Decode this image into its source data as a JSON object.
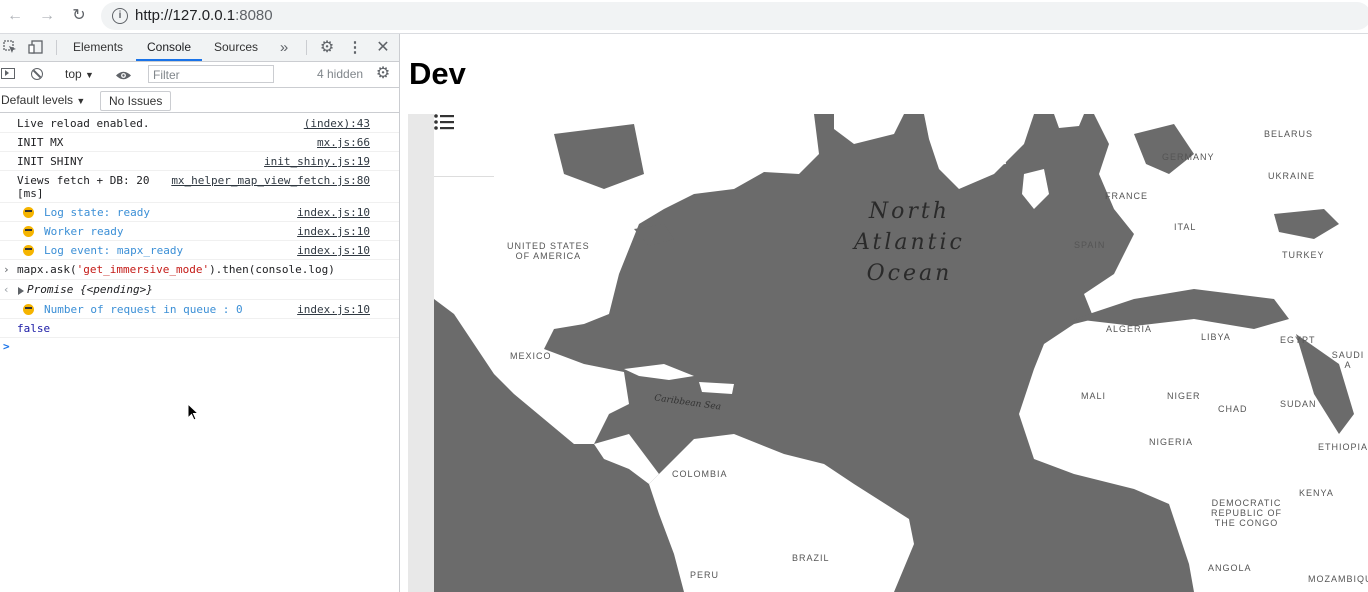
{
  "browser": {
    "url": "http://127.0.0.1:8080",
    "url_host": "http://127.0.0.1",
    "url_port": ":8080"
  },
  "devtools": {
    "tabs": [
      "Elements",
      "Console",
      "Sources"
    ],
    "selected_tab": "Console",
    "context": "top",
    "filter_placeholder": "Filter",
    "hidden_count": "4 hidden",
    "levels": "Default levels",
    "issues": "No Issues",
    "console_rows": [
      {
        "msg": "Live reload enabled.",
        "src": "(index):43"
      },
      {
        "msg": "INIT MX",
        "src": "mx.js:66"
      },
      {
        "msg": "INIT SHINY",
        "src": "init_shiny.js:19"
      },
      {
        "msg": "Views fetch + DB: 20\n[ms]",
        "src": "mx_helper_map_view_fetch.js:80"
      },
      {
        "msg": "Log state: ready",
        "src": "index.js:10"
      },
      {
        "msg": "Worker ready",
        "src": "index.js:10"
      },
      {
        "msg": "Log event: mapx_ready",
        "src": "index.js:10"
      },
      {
        "msg": "mapx.ask('get_immersive_mode').then(console.log)",
        "src": ""
      },
      {
        "msg": "Promise {<pending>}",
        "src": ""
      },
      {
        "msg": "Number of request in queue : 0",
        "src": "index.js:10"
      },
      {
        "msg": "false",
        "src": ""
      }
    ],
    "input_prompt": ">"
  },
  "page": {
    "title": "Dev",
    "map_labels": {
      "usa": "UNITED STATES\nOF AMERICA",
      "mexico": "MEXICO",
      "colombia": "COLOMBIA",
      "brazil": "BRAZIL",
      "peru": "PERU",
      "belarus": "BELARUS",
      "germany": "GERMANY",
      "ukraine": "UKRAINE",
      "france": "FRANCE",
      "spain": "SPAIN",
      "italy": "ITAL",
      "turkey": "TURKEY",
      "algeria": "ALGERIA",
      "libya": "LIBYA",
      "egypt": "EGYPT",
      "saudi": "SAUDI A",
      "mali": "MALI",
      "niger": "NIGER",
      "chad": "CHAD",
      "sudan": "SUDAN",
      "nigeria": "NIGERIA",
      "ethiopia": "ETHIOPIA",
      "kenya": "KENYA",
      "drc": "DEMOCRATIC\nREPUBLIC OF\nTHE CONGO",
      "angola": "ANGOLA",
      "mozambique": "MOZAMBIQUE"
    },
    "ocean_label": "North\nAtlantic\nOcean",
    "sea_label": "Caribbean Sea"
  }
}
